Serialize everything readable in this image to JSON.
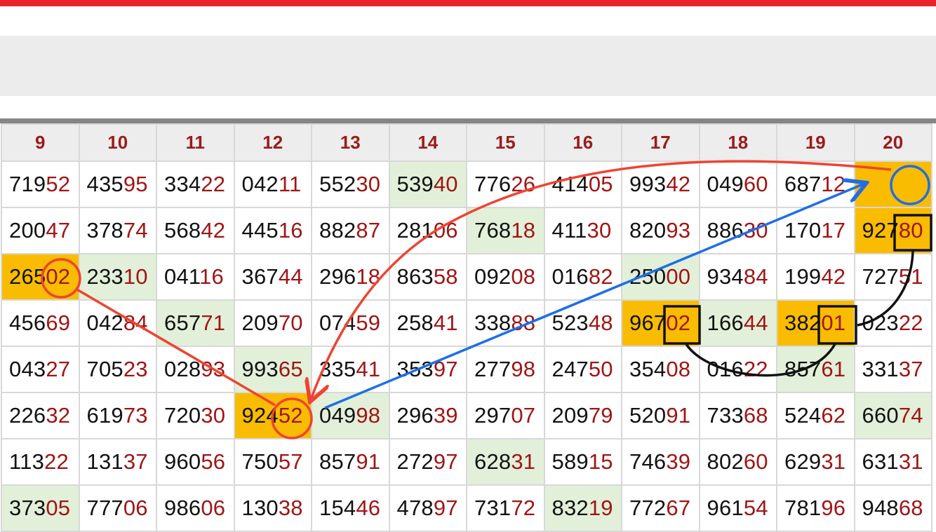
{
  "colors": {
    "top_bar": "#e8232b",
    "header_text": "#9b1b1b",
    "tail_digits": "#a01515",
    "green_cell": "#e2f0d9",
    "orange_cell": "#f9bc00",
    "red_annotation": "#ee4433",
    "blue_annotation": "#1e6ee8",
    "black_annotation": "#111111"
  },
  "columns": [
    "9",
    "10",
    "11",
    "12",
    "13",
    "14",
    "15",
    "16",
    "17",
    "18",
    "19",
    "20"
  ],
  "rows": [
    [
      {
        "h": "719",
        "t": "52"
      },
      {
        "h": "435",
        "t": "95"
      },
      {
        "h": "334",
        "t": "22"
      },
      {
        "h": "042",
        "t": "11"
      },
      {
        "h": "552",
        "t": "30"
      },
      {
        "h": "539",
        "t": "40",
        "hl": "green"
      },
      {
        "h": "776",
        "t": "26"
      },
      {
        "h": "414",
        "t": "05"
      },
      {
        "h": "993",
        "t": "42"
      },
      {
        "h": "049",
        "t": "60"
      },
      {
        "h": "687",
        "t": "12"
      },
      {
        "h": "",
        "t": "",
        "hl": "orange"
      }
    ],
    [
      {
        "h": "200",
        "t": "47"
      },
      {
        "h": "378",
        "t": "74"
      },
      {
        "h": "568",
        "t": "42"
      },
      {
        "h": "445",
        "t": "16"
      },
      {
        "h": "882",
        "t": "87"
      },
      {
        "h": "281",
        "t": "06"
      },
      {
        "h": "768",
        "t": "18",
        "hl": "green"
      },
      {
        "h": "411",
        "t": "30"
      },
      {
        "h": "820",
        "t": "93"
      },
      {
        "h": "886",
        "t": "30"
      },
      {
        "h": "170",
        "t": "17"
      },
      {
        "h": "927",
        "t": "80",
        "hl": "orange"
      }
    ],
    [
      {
        "h": "265",
        "t": "02",
        "hl": "orange"
      },
      {
        "h": "233",
        "t": "10",
        "hl": "green"
      },
      {
        "h": "041",
        "t": "16"
      },
      {
        "h": "367",
        "t": "44"
      },
      {
        "h": "296",
        "t": "18"
      },
      {
        "h": "863",
        "t": "58"
      },
      {
        "h": "092",
        "t": "08"
      },
      {
        "h": "016",
        "t": "82"
      },
      {
        "h": "250",
        "t": "00",
        "hl": "green"
      },
      {
        "h": "934",
        "t": "84"
      },
      {
        "h": "199",
        "t": "42"
      },
      {
        "h": "727",
        "t": "51"
      }
    ],
    [
      {
        "h": "456",
        "t": "69"
      },
      {
        "h": "042",
        "t": "84"
      },
      {
        "h": "657",
        "t": "71",
        "hl": "green"
      },
      {
        "h": "209",
        "t": "70"
      },
      {
        "h": "074",
        "t": "59"
      },
      {
        "h": "258",
        "t": "41"
      },
      {
        "h": "338",
        "t": "88"
      },
      {
        "h": "523",
        "t": "48"
      },
      {
        "h": "967",
        "t": "02",
        "hl": "orange"
      },
      {
        "h": "166",
        "t": "44",
        "hl": "green"
      },
      {
        "h": "382",
        "t": "01",
        "hl": "orange"
      },
      {
        "h": "023",
        "t": "22"
      }
    ],
    [
      {
        "h": "043",
        "t": "27"
      },
      {
        "h": "705",
        "t": "23"
      },
      {
        "h": "028",
        "t": "93"
      },
      {
        "h": "993",
        "t": "65",
        "hl": "green"
      },
      {
        "h": "335",
        "t": "41"
      },
      {
        "h": "353",
        "t": "97"
      },
      {
        "h": "277",
        "t": "98"
      },
      {
        "h": "247",
        "t": "50"
      },
      {
        "h": "354",
        "t": "08"
      },
      {
        "h": "016",
        "t": "22"
      },
      {
        "h": "857",
        "t": "61",
        "hl": "green"
      },
      {
        "h": "331",
        "t": "37"
      }
    ],
    [
      {
        "h": "226",
        "t": "32"
      },
      {
        "h": "619",
        "t": "73"
      },
      {
        "h": "720",
        "t": "30"
      },
      {
        "h": "924",
        "t": "52",
        "hl": "orange"
      },
      {
        "h": "049",
        "t": "98",
        "hl": "green"
      },
      {
        "h": "296",
        "t": "39"
      },
      {
        "h": "297",
        "t": "07"
      },
      {
        "h": "209",
        "t": "79"
      },
      {
        "h": "520",
        "t": "91"
      },
      {
        "h": "733",
        "t": "68"
      },
      {
        "h": "524",
        "t": "62"
      },
      {
        "h": "660",
        "t": "74",
        "hl": "green"
      }
    ],
    [
      {
        "h": "113",
        "t": "22"
      },
      {
        "h": "131",
        "t": "37"
      },
      {
        "h": "960",
        "t": "56"
      },
      {
        "h": "750",
        "t": "57"
      },
      {
        "h": "857",
        "t": "91"
      },
      {
        "h": "272",
        "t": "97"
      },
      {
        "h": "628",
        "t": "31",
        "hl": "green"
      },
      {
        "h": "589",
        "t": "15"
      },
      {
        "h": "746",
        "t": "39"
      },
      {
        "h": "802",
        "t": "60"
      },
      {
        "h": "629",
        "t": "31"
      },
      {
        "h": "631",
        "t": "31"
      }
    ],
    [
      {
        "h": "373",
        "t": "05",
        "hl": "green"
      },
      {
        "h": "777",
        "t": "06"
      },
      {
        "h": "986",
        "t": "06"
      },
      {
        "h": "130",
        "t": "38"
      },
      {
        "h": "154",
        "t": "46"
      },
      {
        "h": "478",
        "t": "97"
      },
      {
        "h": "731",
        "t": "72"
      },
      {
        "h": "832",
        "t": "19",
        "hl": "green"
      },
      {
        "h": "772",
        "t": "67"
      },
      {
        "h": "961",
        "t": "54"
      },
      {
        "h": "781",
        "t": "96"
      },
      {
        "h": "948",
        "t": "68"
      }
    ]
  ]
}
